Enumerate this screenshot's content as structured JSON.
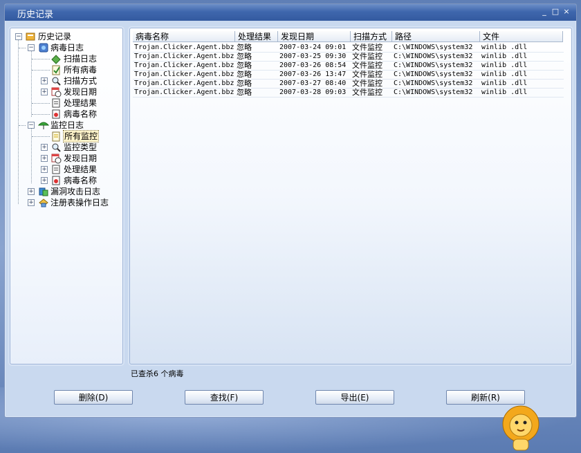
{
  "window": {
    "title": "历史记录"
  },
  "window_controls": {
    "minimize": "_",
    "maximize": "□",
    "close": "×"
  },
  "tree": {
    "root": "历史记录",
    "virus_log": {
      "label": "病毒日志",
      "children": [
        "扫描日志",
        "所有病毒",
        "扫描方式",
        "发现日期",
        "处理结果",
        "病毒名称"
      ]
    },
    "monitor_log": {
      "label": "监控日志",
      "children": [
        "所有监控",
        "监控类型",
        "发现日期",
        "处理结果",
        "病毒名称"
      ]
    },
    "vuln_log": "漏洞攻击日志",
    "registry_log": "注册表操作日志",
    "selected": "所有监控"
  },
  "table": {
    "columns": [
      "病毒名称",
      "处理结果",
      "发现日期",
      "扫描方式",
      "路径",
      "文件"
    ],
    "rows": [
      [
        "Trojan.Clicker.Agent.bbz",
        "忽略",
        "2007-03-24 09:01",
        "文件监控",
        "C:\\WINDOWS\\system32",
        "winlib .dll"
      ],
      [
        "Trojan.Clicker.Agent.bbz",
        "忽略",
        "2007-03-25 09:30",
        "文件监控",
        "C:\\WINDOWS\\system32",
        "winlib .dll"
      ],
      [
        "Trojan.Clicker.Agent.bbz",
        "忽略",
        "2007-03-26 08:54",
        "文件监控",
        "C:\\WINDOWS\\system32",
        "winlib .dll"
      ],
      [
        "Trojan.Clicker.Agent.bbz",
        "忽略",
        "2007-03-26 13:47",
        "文件监控",
        "C:\\WINDOWS\\system32",
        "winlib .dll"
      ],
      [
        "Trojan.Clicker.Agent.bbz",
        "忽略",
        "2007-03-27 08:40",
        "文件监控",
        "C:\\WINDOWS\\system32",
        "winlib .dll"
      ],
      [
        "Trojan.Clicker.Agent.bbz",
        "忽略",
        "2007-03-28 09:03",
        "文件监控",
        "C:\\WINDOWS\\system32",
        "winlib .dll"
      ]
    ]
  },
  "status": {
    "text": "已查杀6 个病毒"
  },
  "buttons": {
    "delete": "删除(D)",
    "find": "查找(F)",
    "export": "导出(E)",
    "refresh": "刷新(R)"
  },
  "colors": {
    "titlebar": "#3f67ad",
    "panel_border": "#9fb5d8",
    "selection": "#fff3c9"
  }
}
